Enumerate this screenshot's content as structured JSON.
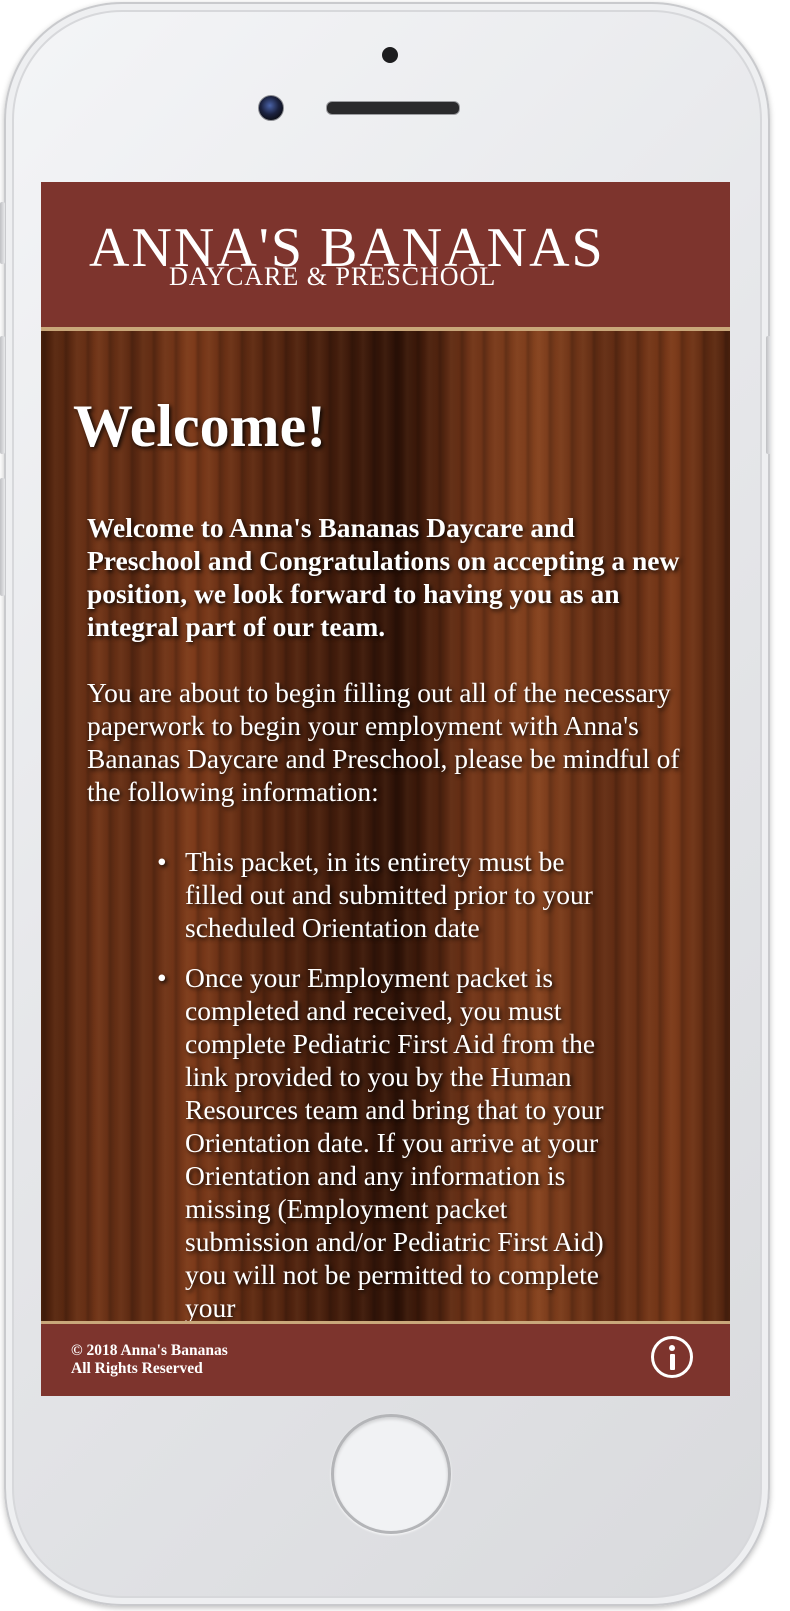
{
  "header": {
    "logo_title": "ANNA'S BANANAS",
    "logo_subtitle": "DAYCARE & PRESCHOOL"
  },
  "main": {
    "title": "Welcome!",
    "intro": "Welcome to Anna's Bananas Daycare and Preschool and Congratulations on accepting a new position, we look forward to having you as an integral part of our team.",
    "instructions": "You are about to begin filling out all of the necessary paperwork to begin your employment with Anna's Bananas Daycare and Preschool, please be mindful of the following information:",
    "list_items": [
      "This packet, in its entirety must be filled out and submitted prior to your scheduled Orientation date",
      "Once your Employment packet is completed and received, you must complete Pediatric First Aid from the link provided to you by the Human Resources team and bring that to your Orientation date. If you arrive at your Orientation and any information is missing (Employment packet submission and/or Pediatric First Aid) you will not be permitted to complete your"
    ]
  },
  "footer": {
    "copyright_line1": "© 2018 Anna's Bananas",
    "copyright_line2": "All Rights Reserved",
    "info_icon": "info-circle-icon"
  },
  "colors": {
    "header_bg": "#7d342d",
    "accent_border": "#c9a77a",
    "text": "#ffffff"
  }
}
